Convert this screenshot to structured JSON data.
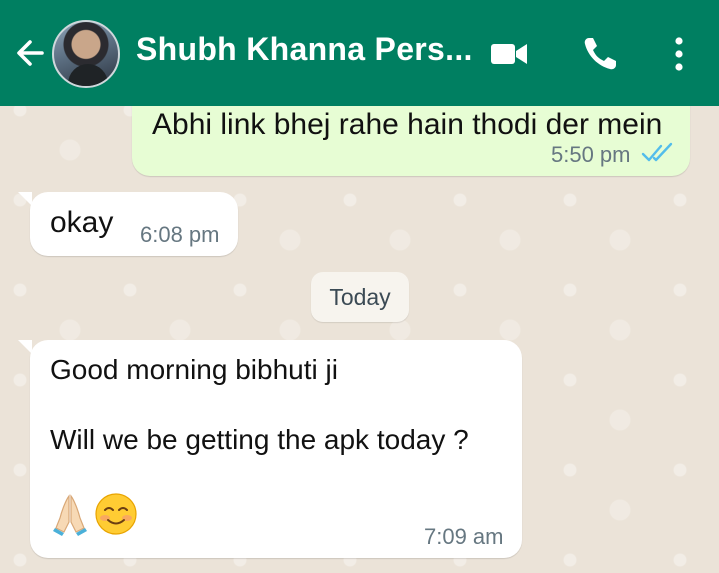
{
  "header": {
    "contact_name": "Shubh Khanna Pers...",
    "background_color": "#007f61"
  },
  "icons": {
    "back": "arrow-left",
    "video": "video-camera",
    "call": "phone",
    "menu": "more-vertical"
  },
  "messages": [
    {
      "direction": "outgoing",
      "text": "Abhi link bhej rahe hain thodi der mein",
      "time": "5:50 pm",
      "status": "read",
      "status_color": "#53bdeb",
      "bubble_color": "#e7fdd4"
    },
    {
      "direction": "incoming",
      "text": "okay",
      "time": "6:08 pm"
    },
    {
      "direction": "incoming",
      "lines": [
        "Good morning bibhuti ji",
        "Will we be getting the apk today ?"
      ],
      "emojis": [
        "folded-hands",
        "smiling-face"
      ],
      "time": "7:09 am"
    }
  ],
  "date_separator": "Today"
}
